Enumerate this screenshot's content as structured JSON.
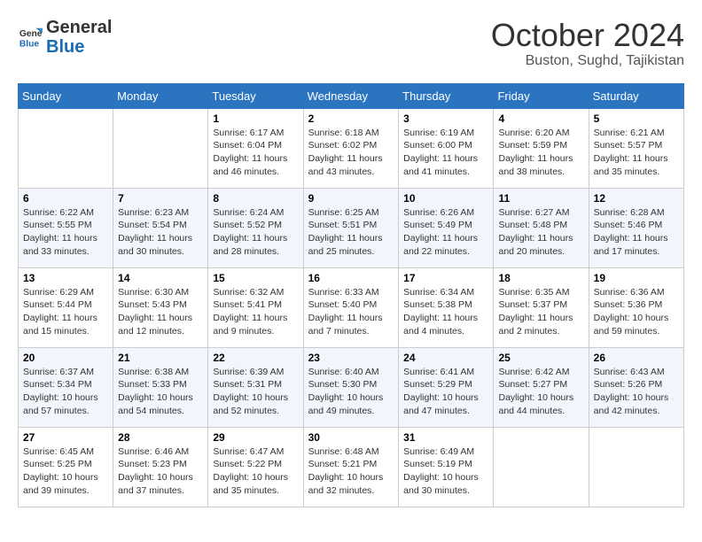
{
  "logo": {
    "general": "General",
    "blue": "Blue"
  },
  "header": {
    "month": "October 2024",
    "location": "Buston, Sughd, Tajikistan"
  },
  "weekdays": [
    "Sunday",
    "Monday",
    "Tuesday",
    "Wednesday",
    "Thursday",
    "Friday",
    "Saturday"
  ],
  "weeks": [
    [
      {
        "day": null
      },
      {
        "day": null
      },
      {
        "day": "1",
        "sunrise": "6:17 AM",
        "sunset": "6:04 PM",
        "daylight": "11 hours and 46 minutes."
      },
      {
        "day": "2",
        "sunrise": "6:18 AM",
        "sunset": "6:02 PM",
        "daylight": "11 hours and 43 minutes."
      },
      {
        "day": "3",
        "sunrise": "6:19 AM",
        "sunset": "6:00 PM",
        "daylight": "11 hours and 41 minutes."
      },
      {
        "day": "4",
        "sunrise": "6:20 AM",
        "sunset": "5:59 PM",
        "daylight": "11 hours and 38 minutes."
      },
      {
        "day": "5",
        "sunrise": "6:21 AM",
        "sunset": "5:57 PM",
        "daylight": "11 hours and 35 minutes."
      }
    ],
    [
      {
        "day": "6",
        "sunrise": "6:22 AM",
        "sunset": "5:55 PM",
        "daylight": "11 hours and 33 minutes."
      },
      {
        "day": "7",
        "sunrise": "6:23 AM",
        "sunset": "5:54 PM",
        "daylight": "11 hours and 30 minutes."
      },
      {
        "day": "8",
        "sunrise": "6:24 AM",
        "sunset": "5:52 PM",
        "daylight": "11 hours and 28 minutes."
      },
      {
        "day": "9",
        "sunrise": "6:25 AM",
        "sunset": "5:51 PM",
        "daylight": "11 hours and 25 minutes."
      },
      {
        "day": "10",
        "sunrise": "6:26 AM",
        "sunset": "5:49 PM",
        "daylight": "11 hours and 22 minutes."
      },
      {
        "day": "11",
        "sunrise": "6:27 AM",
        "sunset": "5:48 PM",
        "daylight": "11 hours and 20 minutes."
      },
      {
        "day": "12",
        "sunrise": "6:28 AM",
        "sunset": "5:46 PM",
        "daylight": "11 hours and 17 minutes."
      }
    ],
    [
      {
        "day": "13",
        "sunrise": "6:29 AM",
        "sunset": "5:44 PM",
        "daylight": "11 hours and 15 minutes."
      },
      {
        "day": "14",
        "sunrise": "6:30 AM",
        "sunset": "5:43 PM",
        "daylight": "11 hours and 12 minutes."
      },
      {
        "day": "15",
        "sunrise": "6:32 AM",
        "sunset": "5:41 PM",
        "daylight": "11 hours and 9 minutes."
      },
      {
        "day": "16",
        "sunrise": "6:33 AM",
        "sunset": "5:40 PM",
        "daylight": "11 hours and 7 minutes."
      },
      {
        "day": "17",
        "sunrise": "6:34 AM",
        "sunset": "5:38 PM",
        "daylight": "11 hours and 4 minutes."
      },
      {
        "day": "18",
        "sunrise": "6:35 AM",
        "sunset": "5:37 PM",
        "daylight": "11 hours and 2 minutes."
      },
      {
        "day": "19",
        "sunrise": "6:36 AM",
        "sunset": "5:36 PM",
        "daylight": "10 hours and 59 minutes."
      }
    ],
    [
      {
        "day": "20",
        "sunrise": "6:37 AM",
        "sunset": "5:34 PM",
        "daylight": "10 hours and 57 minutes."
      },
      {
        "day": "21",
        "sunrise": "6:38 AM",
        "sunset": "5:33 PM",
        "daylight": "10 hours and 54 minutes."
      },
      {
        "day": "22",
        "sunrise": "6:39 AM",
        "sunset": "5:31 PM",
        "daylight": "10 hours and 52 minutes."
      },
      {
        "day": "23",
        "sunrise": "6:40 AM",
        "sunset": "5:30 PM",
        "daylight": "10 hours and 49 minutes."
      },
      {
        "day": "24",
        "sunrise": "6:41 AM",
        "sunset": "5:29 PM",
        "daylight": "10 hours and 47 minutes."
      },
      {
        "day": "25",
        "sunrise": "6:42 AM",
        "sunset": "5:27 PM",
        "daylight": "10 hours and 44 minutes."
      },
      {
        "day": "26",
        "sunrise": "6:43 AM",
        "sunset": "5:26 PM",
        "daylight": "10 hours and 42 minutes."
      }
    ],
    [
      {
        "day": "27",
        "sunrise": "6:45 AM",
        "sunset": "5:25 PM",
        "daylight": "10 hours and 39 minutes."
      },
      {
        "day": "28",
        "sunrise": "6:46 AM",
        "sunset": "5:23 PM",
        "daylight": "10 hours and 37 minutes."
      },
      {
        "day": "29",
        "sunrise": "6:47 AM",
        "sunset": "5:22 PM",
        "daylight": "10 hours and 35 minutes."
      },
      {
        "day": "30",
        "sunrise": "6:48 AM",
        "sunset": "5:21 PM",
        "daylight": "10 hours and 32 minutes."
      },
      {
        "day": "31",
        "sunrise": "6:49 AM",
        "sunset": "5:19 PM",
        "daylight": "10 hours and 30 minutes."
      },
      {
        "day": null
      },
      {
        "day": null
      }
    ]
  ],
  "labels": {
    "sunrise": "Sunrise:",
    "sunset": "Sunset:",
    "daylight": "Daylight:"
  }
}
